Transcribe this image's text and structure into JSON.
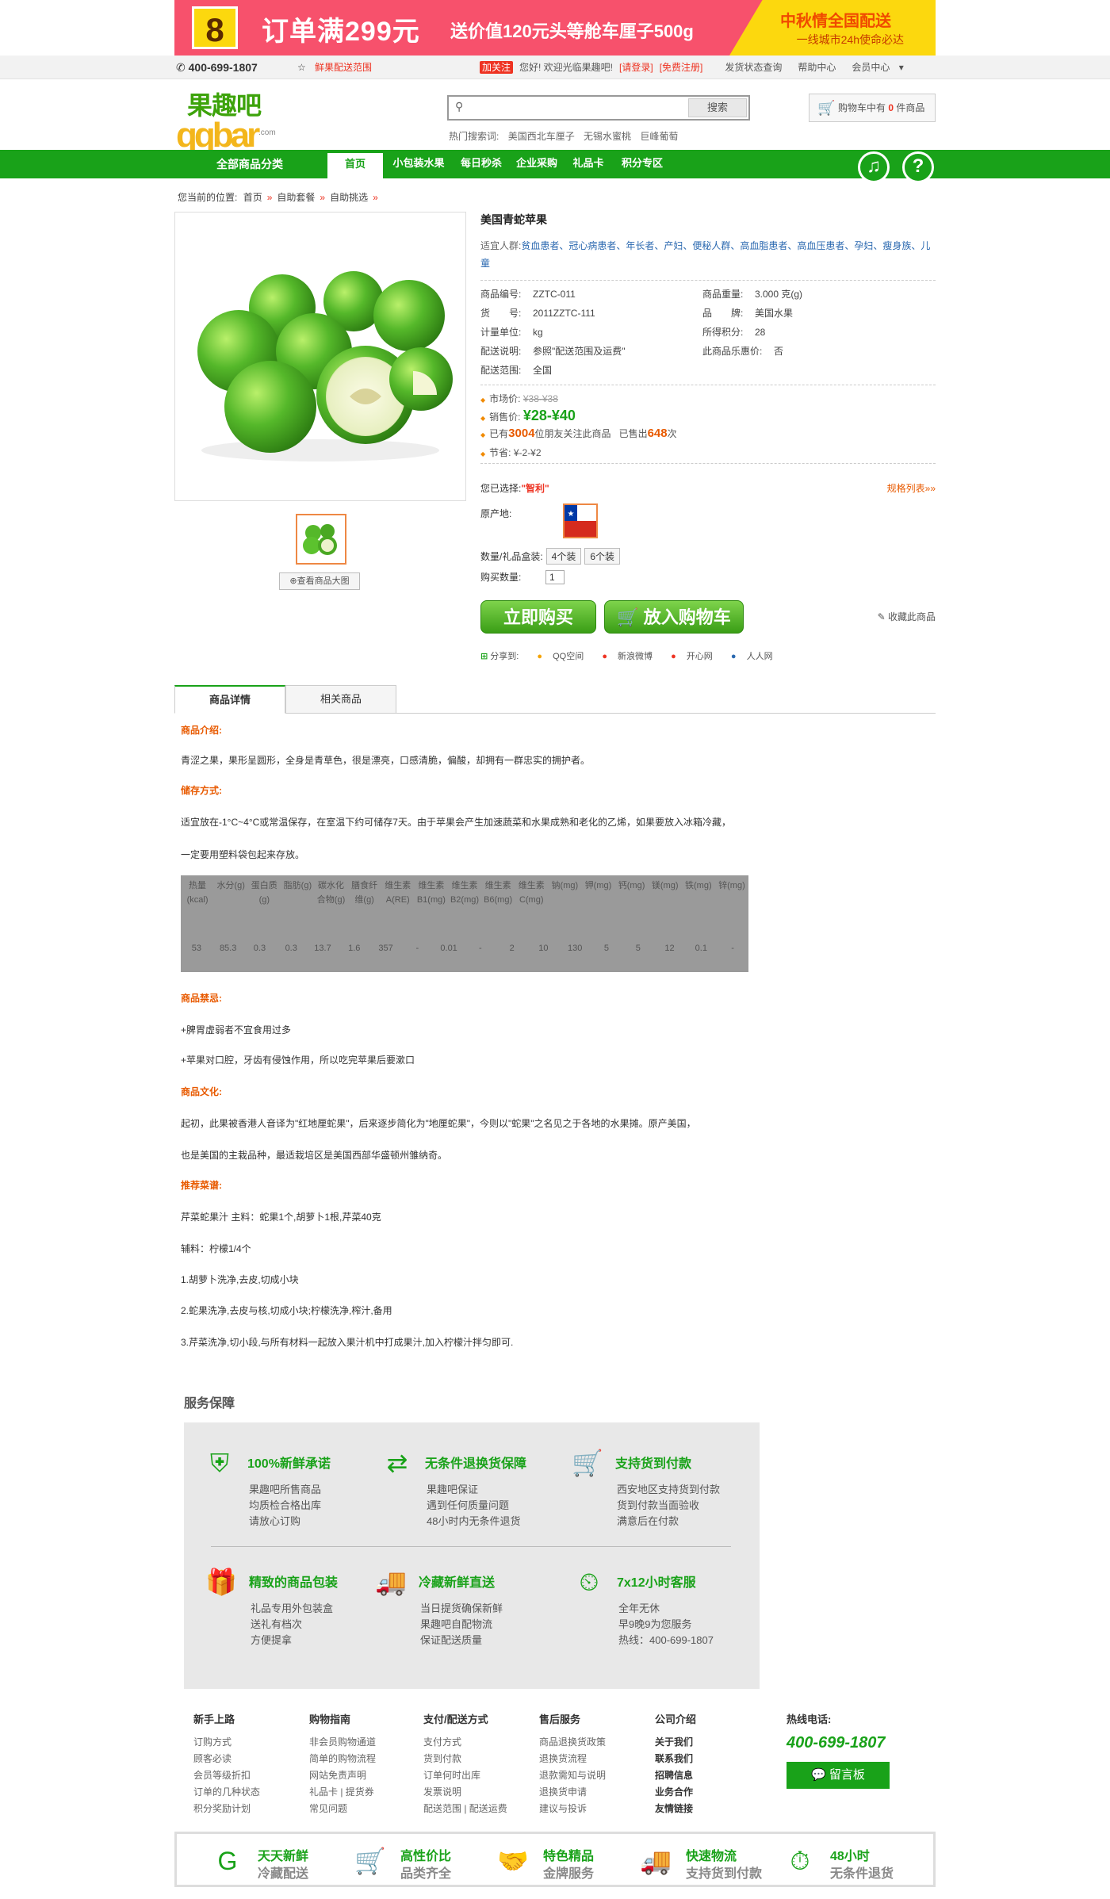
{
  "banner": {
    "badge": "8",
    "title": "订单满299元",
    "subtitle": "送价值120元头等舱车厘子500g",
    "right_title": "中秋情全国配送",
    "right_sub": "一线城市24h使命必达"
  },
  "topbar": {
    "phone": "400-699-1807",
    "fresh_range": "鲜果配送范围",
    "follow": "加关注",
    "greeting": "您好! 欢迎光临果趣吧!",
    "login": "[请登录]",
    "register": "[免费注册]",
    "order_query": "发货状态查询",
    "help": "帮助中心",
    "member": "会员中心"
  },
  "logo": {
    "cn": "果趣吧",
    "en": "qqbar",
    "suffix": ".com"
  },
  "search": {
    "placeholder": "",
    "button": "搜索",
    "hot_label": "热门搜索词:",
    "hot": [
      "美国西北车厘子",
      "无锡水蜜桃",
      "巨峰葡萄"
    ]
  },
  "cart": {
    "prefix": "购物车中有",
    "count": "0",
    "suffix": "件商品"
  },
  "nav": {
    "all": "全部商品分类",
    "items": [
      "首页",
      "小包装水果",
      "每日秒杀",
      "企业采购",
      "礼品卡",
      "积分专区"
    ]
  },
  "breadcrumb": {
    "prefix": "您当前的位置:",
    "items": [
      "首页",
      "自助套餐",
      "自助挑选"
    ]
  },
  "gallery": {
    "view_big": "查看商品大图"
  },
  "product": {
    "title": "美国青蛇苹果",
    "suit_label": "适宜人群:",
    "suit": "贫血患者、冠心病患者、年长者、产妇、便秘人群、高血脂患者、高血压患者、孕妇、瘦身族、儿童",
    "fields_left": [
      [
        "商品编号:",
        "ZZTC-011"
      ],
      [
        "货　　号:",
        "2011ZZTC-111"
      ],
      [
        "计量单位:",
        "kg"
      ],
      [
        "配送说明:",
        "参照\"配送范围及运费\""
      ],
      [
        "配送范围:",
        "全国"
      ]
    ],
    "fields_right": [
      [
        "商品重量:",
        "3.000 克(g)"
      ],
      [
        "品　　牌:",
        "美国水果"
      ],
      [
        "所得积分:",
        "28"
      ],
      [
        "此商品乐惠价:",
        "否"
      ]
    ],
    "market_label": "市场价:",
    "market_price": "¥38-¥38",
    "sale_label": "销售价:",
    "sale_price": "¥28-¥40",
    "follow_pre": "已有",
    "follow_num": "3004",
    "follow_mid": "位朋友关注此商品",
    "sold_pre": "已售出",
    "sold_num": "648",
    "sold_suf": "次",
    "save_label": "节省:",
    "save": "¥-2-¥2",
    "chosen_label": "您已选择:",
    "chosen": "\"智利\"",
    "spec_list": "规格列表»»",
    "origin_label": "原产地:",
    "qty_label": "数量/礼品盒装:",
    "qty_opts": [
      "4个装",
      "6个装"
    ],
    "buy_qty_label": "购买数量:",
    "buy_qty": "1",
    "buy_now": "立即购买",
    "add_cart": "放入购物车",
    "favorite": "收藏此商品",
    "share_label": "分享到:",
    "share": [
      "QQ空间",
      "新浪微博",
      "开心网",
      "人人网"
    ]
  },
  "tabs": [
    "商品详情",
    "相关商品"
  ],
  "detail": {
    "intro_h": "商品介绍:",
    "intro": "青涩之果，果形呈圆形，全身是青草色，很是漂亮，口感清脆，偏酸，却拥有一群忠实的拥护者。",
    "store_h": "储存方式:",
    "store1": "适宜放在-1°C~4°C或常温保存，在室温下约可储存7天。由于苹果会产生加速蔬菜和水果成熟和老化的乙烯，如果要放入冰箱冷藏，",
    "store2": "一定要用塑料袋包起来存放。",
    "nutri_head": [
      "热量(kcal)",
      "水分(g)",
      "蛋白质(g)",
      "脂肪(g)",
      "碳水化合物(g)",
      "膳食纤维(g)",
      "维生素A(RE)",
      "维生素B1(mg)",
      "维生素B2(mg)",
      "维生素B6(mg)",
      "维生素C(mg)",
      "钠(mg)",
      "钾(mg)",
      "钙(mg)",
      "镁(mg)",
      "铁(mg)",
      "锌(mg)"
    ],
    "nutri_vals": [
      "53",
      "85.3",
      "0.3",
      "0.3",
      "13.7",
      "1.6",
      "357",
      "-",
      "0.01",
      "-",
      "2",
      "10",
      "130",
      "5",
      "5",
      "12",
      "0.1",
      "-"
    ],
    "taboo_h": "商品禁忌:",
    "taboo1": "+脾胃虚弱者不宜食用过多",
    "taboo2": "+苹果对口腔，牙齿有侵蚀作用，所以吃完苹果后要漱口",
    "culture_h": "商品文化:",
    "culture1": "起初，此果被香港人音译为\"红地厘蛇果\"，后来逐步简化为\"地厘蛇果\"，今则以\"蛇果\"之名见之于各地的水果摊。原产美国，",
    "culture2": "也是美国的主栽品种，最适栽培区是美国西部华盛顿州雏纳奇。",
    "recipe_h": "推荐菜谱:",
    "recipe1": "芹菜蛇果汁 主料：蛇果1个,胡萝卜1根,芹菜40克",
    "recipe2": "辅料：柠檬1/4个",
    "recipe3": "1.胡萝卜洗净,去皮,切成小块",
    "recipe4": "2.蛇果洗净,去皮与核,切成小块;柠檬洗净,榨汁,备用",
    "recipe5": "3.芹菜洗净,切小段,与所有材料一起放入果汁机中打成果汁,加入柠檬汁拌匀即可."
  },
  "service": {
    "title": "服务保障",
    "items": [
      {
        "icon": "shield-icon",
        "h": "100%新鲜承诺",
        "l": [
          "果趣吧所售商品",
          "均质检合格出库",
          "请放心订购"
        ]
      },
      {
        "icon": "return-icon",
        "h": "无条件退换货保障",
        "l": [
          "果趣吧保证",
          "遇到任何质量问题",
          "48小时内无条件退货"
        ]
      },
      {
        "icon": "cart-icon",
        "h": "支持货到付款",
        "l": [
          "西安地区支持货到付款",
          "货到付款当面验收",
          "满意后在付款"
        ]
      },
      {
        "icon": "gift-icon",
        "h": "精致的商品包装",
        "l": [
          "礼品专用外包装盒",
          "送礼有档次",
          "方便提拿"
        ]
      },
      {
        "icon": "truck-icon",
        "h": "冷藏新鲜直送",
        "l": [
          "当日提货确保新鲜",
          "果趣吧自配物流",
          "保证配送质量"
        ]
      },
      {
        "icon": "clock-icon",
        "h": "7x12小时客服",
        "l": [
          "全年无休",
          "早9晚9为您服务",
          "热线：400-699-1807"
        ]
      }
    ]
  },
  "footer": {
    "cols": [
      {
        "h": "新手上路",
        "items": [
          "订购方式",
          "顾客必读",
          "会员等级折扣",
          "订单的几种状态",
          "积分奖励计划"
        ]
      },
      {
        "h": "购物指南",
        "items": [
          "非会员购物通道",
          "简单的购物流程",
          "网站免责声明",
          "礼品卡 | 提货券",
          "常见问题"
        ]
      },
      {
        "h": "支付/配送方式",
        "items": [
          "支付方式",
          "货到付款",
          "订单何时出库",
          "发票说明",
          "配送范围 | 配送运费"
        ]
      },
      {
        "h": "售后服务",
        "items": [
          "商品退换货政策",
          "退换货流程",
          "退款需知与说明",
          "退换货申请",
          "建议与投诉"
        ]
      },
      {
        "h": "公司介绍",
        "items": [
          "关于我们",
          "联系我们",
          "招聘信息",
          "业务合作",
          "友情链接"
        ]
      }
    ],
    "hotline_label": "热线电话:",
    "hotline": "400-699-1807",
    "msg": "留言板",
    "bottom": [
      {
        "icon": "g-logo-icon",
        "a": "天天新鲜",
        "b": "冷藏配送"
      },
      {
        "icon": "shopping-cart-icon",
        "a": "高性价比",
        "b": "品类齐全"
      },
      {
        "icon": "handshake-icon",
        "a": "特色精品",
        "b": "金牌服务"
      },
      {
        "icon": "delivery-truck-icon",
        "a": "快速物流",
        "b": "支持货到付款"
      },
      {
        "icon": "48h-icon",
        "a": "48小时",
        "b": "无条件退货"
      }
    ]
  },
  "colors": {
    "brand_green": "#19a219",
    "banner_pink": "#f7516c",
    "banner_yellow": "#fcd80e",
    "accent_orange": "#e85a00"
  }
}
